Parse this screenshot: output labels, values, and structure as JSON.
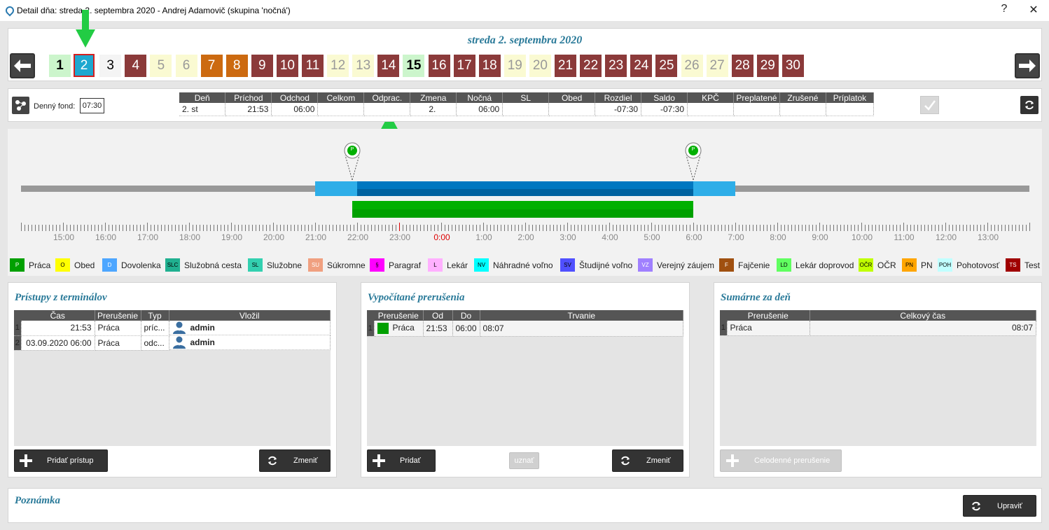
{
  "window": {
    "title": "Detail dňa: streda 2. septembra 2020 -  Andrej Adamovič  (skupina 'nočná')",
    "help": "?",
    "close": "✕"
  },
  "header": {
    "date_title": "streda 2. septembra 2020"
  },
  "days": [
    {
      "n": "1",
      "style": "green"
    },
    {
      "n": "2",
      "style": "sel"
    },
    {
      "n": "3",
      "style": "white"
    },
    {
      "n": "4",
      "style": "red"
    },
    {
      "n": "5",
      "style": "yellow"
    },
    {
      "n": "6",
      "style": "yellow"
    },
    {
      "n": "7",
      "style": "orange"
    },
    {
      "n": "8",
      "style": "orange"
    },
    {
      "n": "9",
      "style": "red"
    },
    {
      "n": "10",
      "style": "red"
    },
    {
      "n": "11",
      "style": "red"
    },
    {
      "n": "12",
      "style": "yellow"
    },
    {
      "n": "13",
      "style": "yellow"
    },
    {
      "n": "14",
      "style": "red"
    },
    {
      "n": "15",
      "style": "green"
    },
    {
      "n": "16",
      "style": "red"
    },
    {
      "n": "17",
      "style": "red"
    },
    {
      "n": "18",
      "style": "red"
    },
    {
      "n": "19",
      "style": "yellow"
    },
    {
      "n": "20",
      "style": "yellow"
    },
    {
      "n": "21",
      "style": "red"
    },
    {
      "n": "22",
      "style": "red"
    },
    {
      "n": "23",
      "style": "red"
    },
    {
      "n": "24",
      "style": "red"
    },
    {
      "n": "25",
      "style": "red"
    },
    {
      "n": "26",
      "style": "yellow"
    },
    {
      "n": "27",
      "style": "yellow"
    },
    {
      "n": "28",
      "style": "red"
    },
    {
      "n": "29",
      "style": "red"
    },
    {
      "n": "30",
      "style": "red"
    }
  ],
  "summary": {
    "fund_label": "Denný fond:",
    "fund_value": "07:30",
    "columns": [
      "Deň",
      "Príchod",
      "Odchod",
      "Celkom",
      "Odprac.",
      "Zmena",
      "Nočná",
      "SL",
      "Obed",
      "Rozdiel",
      "Saldo",
      "KPČ",
      "Preplatené",
      "Zrušené",
      "Príplatok"
    ],
    "row": [
      "2. st",
      "21:53",
      "06:00",
      "",
      "",
      "2.",
      "06:00",
      "",
      "",
      "-07:30",
      "-07:30",
      "",
      "",
      "",
      ""
    ]
  },
  "timeline": {
    "ticks": [
      "15:00",
      "16:00",
      "17:00",
      "18:00",
      "19:00",
      "20:00",
      "21:00",
      "22:00",
      "23:00",
      "0:00",
      "1:00",
      "2:00",
      "3:00",
      "4:00",
      "5:00",
      "6:00",
      "7:00",
      "8:00",
      "9:00",
      "10:00",
      "11:00",
      "12:00",
      "13:00"
    ],
    "marker_letter": "P",
    "highlight_tick": "0:00"
  },
  "legend": [
    {
      "code": "P",
      "label": "Práca",
      "bg": "#00a000",
      "fg": "#fff"
    },
    {
      "code": "O",
      "label": "Obed",
      "bg": "#ffff00",
      "fg": "#000"
    },
    {
      "code": "D",
      "label": "Dovolenka",
      "bg": "#4da6ff",
      "fg": "#fff"
    },
    {
      "code": "SLC",
      "label": "Služobná cesta",
      "bg": "#20b090",
      "fg": "#000"
    },
    {
      "code": "SL",
      "label": "Služobne",
      "bg": "#33d0b0",
      "fg": "#000"
    },
    {
      "code": "SU",
      "label": "Súkromne",
      "bg": "#f0a080",
      "fg": "#fff"
    },
    {
      "code": "§",
      "label": "Paragraf",
      "bg": "#ff00ff",
      "fg": "#000"
    },
    {
      "code": "L",
      "label": "Lekár",
      "bg": "#ffb0ff",
      "fg": "#000"
    },
    {
      "code": "NV",
      "label": "Náhradné voľno",
      "bg": "#00ffff",
      "fg": "#000"
    },
    {
      "code": "SV",
      "label": "Študijné voľno",
      "bg": "#5050ff",
      "fg": "#000"
    },
    {
      "code": "VZ",
      "label": "Verejný záujem",
      "bg": "#a080ff",
      "fg": "#fff"
    },
    {
      "code": "F",
      "label": "Fajčenie",
      "bg": "#a05010",
      "fg": "#fff"
    },
    {
      "code": "LD",
      "label": "Lekár doprovod",
      "bg": "#60ff60",
      "fg": "#000"
    },
    {
      "code": "OČR",
      "label": "OČR",
      "bg": "#c0ff00",
      "fg": "#000"
    },
    {
      "code": "PN",
      "label": "PN",
      "bg": "#ffa500",
      "fg": "#000"
    },
    {
      "code": "POH",
      "label": "Pohotovosť",
      "bg": "#c0ffff",
      "fg": "#000"
    },
    {
      "code": "TS",
      "label": "Test",
      "bg": "#a00000",
      "fg": "#fff"
    }
  ],
  "access": {
    "title": "Prístupy z terminálov",
    "columns": [
      "Čas",
      "Prerušenie",
      "Typ",
      "Vložil"
    ],
    "rows": [
      {
        "n": "1",
        "time": "21:53",
        "type": "Práca",
        "kind": "príc...",
        "by": "admin"
      },
      {
        "n": "2",
        "time": "03.09.2020 06:00",
        "type": "Práca",
        "kind": "odc...",
        "by": "admin"
      }
    ],
    "add_label": "Pridať prístup",
    "change_label": "Zmeniť"
  },
  "computed": {
    "title": "Vypočítané prerušenia",
    "columns": [
      "Prerušenie",
      "Od",
      "Do",
      "Trvanie"
    ],
    "rows": [
      {
        "n": "1",
        "type": "Práca",
        "from": "21:53",
        "to": "06:00",
        "dur": "08:07"
      }
    ],
    "add_label": "Pridať",
    "accept_label": "uznať",
    "change_label": "Zmeniť"
  },
  "daily": {
    "title": "Sumárne za deň",
    "columns": [
      "Prerušenie",
      "Celkový čas"
    ],
    "rows": [
      {
        "n": "1",
        "type": "Práca",
        "total": "08:07"
      }
    ],
    "allday_label": "Celodenné prerušenie"
  },
  "note": {
    "title": "Poznámka",
    "edit_label": "Upraviť"
  }
}
